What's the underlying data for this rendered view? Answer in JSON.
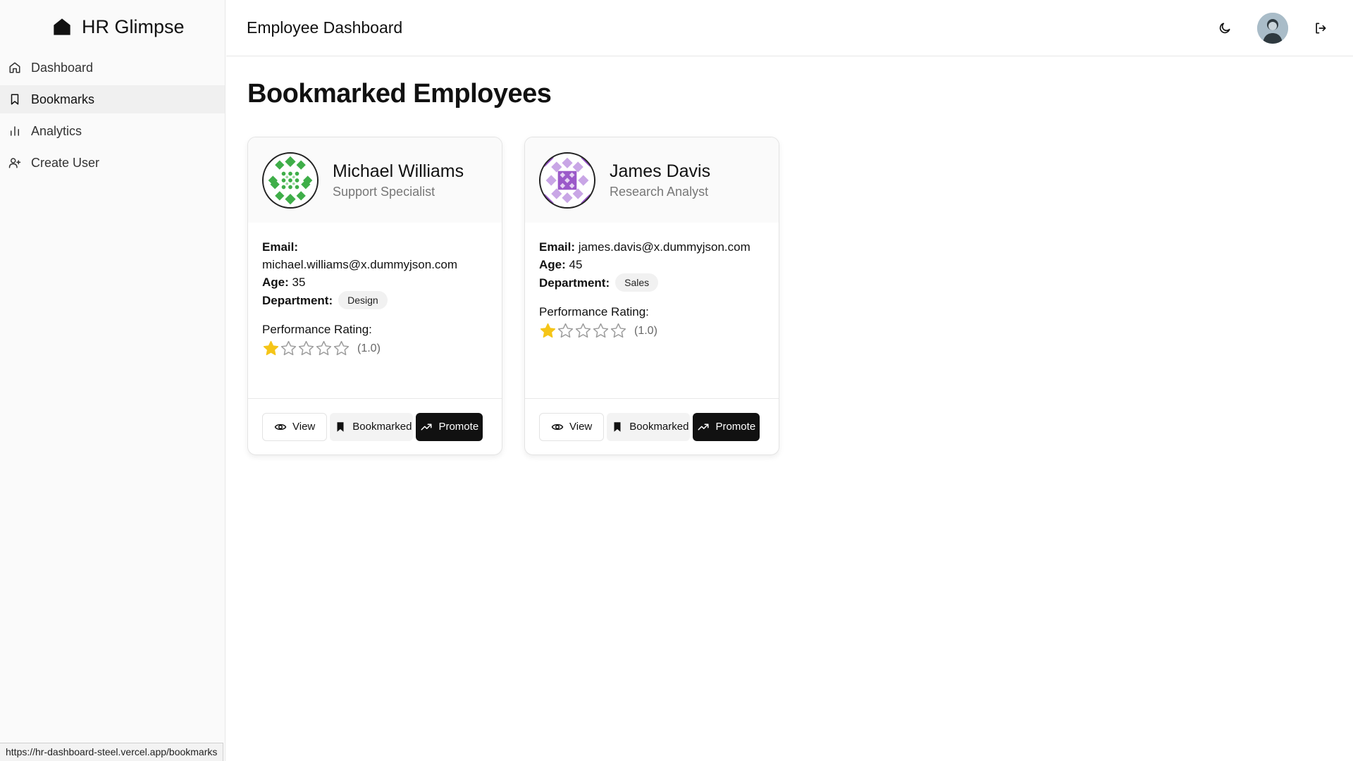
{
  "app": {
    "name": "HR Glimpse"
  },
  "sidebar": {
    "items": [
      {
        "label": "Dashboard",
        "icon": "home-icon"
      },
      {
        "label": "Bookmarks",
        "icon": "bookmark-icon",
        "active": true
      },
      {
        "label": "Analytics",
        "icon": "bar-chart-icon"
      },
      {
        "label": "Create User",
        "icon": "user-plus-icon"
      }
    ]
  },
  "header": {
    "title": "Employee Dashboard"
  },
  "main": {
    "title": "Bookmarked Employees",
    "employees": [
      {
        "name": "Michael Williams",
        "role": "Support Specialist",
        "email_label": "Email:",
        "email": "michael.williams@x.dummyjson.com",
        "age_label": "Age:",
        "age": "35",
        "department_label": "Department:",
        "department": "Design",
        "performance_label": "Performance Rating:",
        "rating": 1,
        "rating_max": 5,
        "rating_text": "(1.0)",
        "avatar_color": "#3fae49",
        "actions": {
          "view": "View",
          "bookmarked": "Bookmarked",
          "promote": "Promote"
        }
      },
      {
        "name": "James Davis",
        "role": "Research Analyst",
        "email_label": "Email:",
        "email": "james.davis@x.dummyjson.com",
        "age_label": "Age:",
        "age": "45",
        "department_label": "Department:",
        "department": "Sales",
        "performance_label": "Performance Rating:",
        "rating": 1,
        "rating_max": 5,
        "rating_text": "(1.0)",
        "avatar_color": "#9b59c9",
        "actions": {
          "view": "View",
          "bookmarked": "Bookmarked",
          "promote": "Promote"
        }
      }
    ]
  },
  "status_bar": {
    "url": "https://hr-dashboard-steel.vercel.app/bookmarks"
  },
  "colors": {
    "star_filled": "#f5c518",
    "star_empty": "#9a9a9a",
    "primary_button": "#111111"
  }
}
